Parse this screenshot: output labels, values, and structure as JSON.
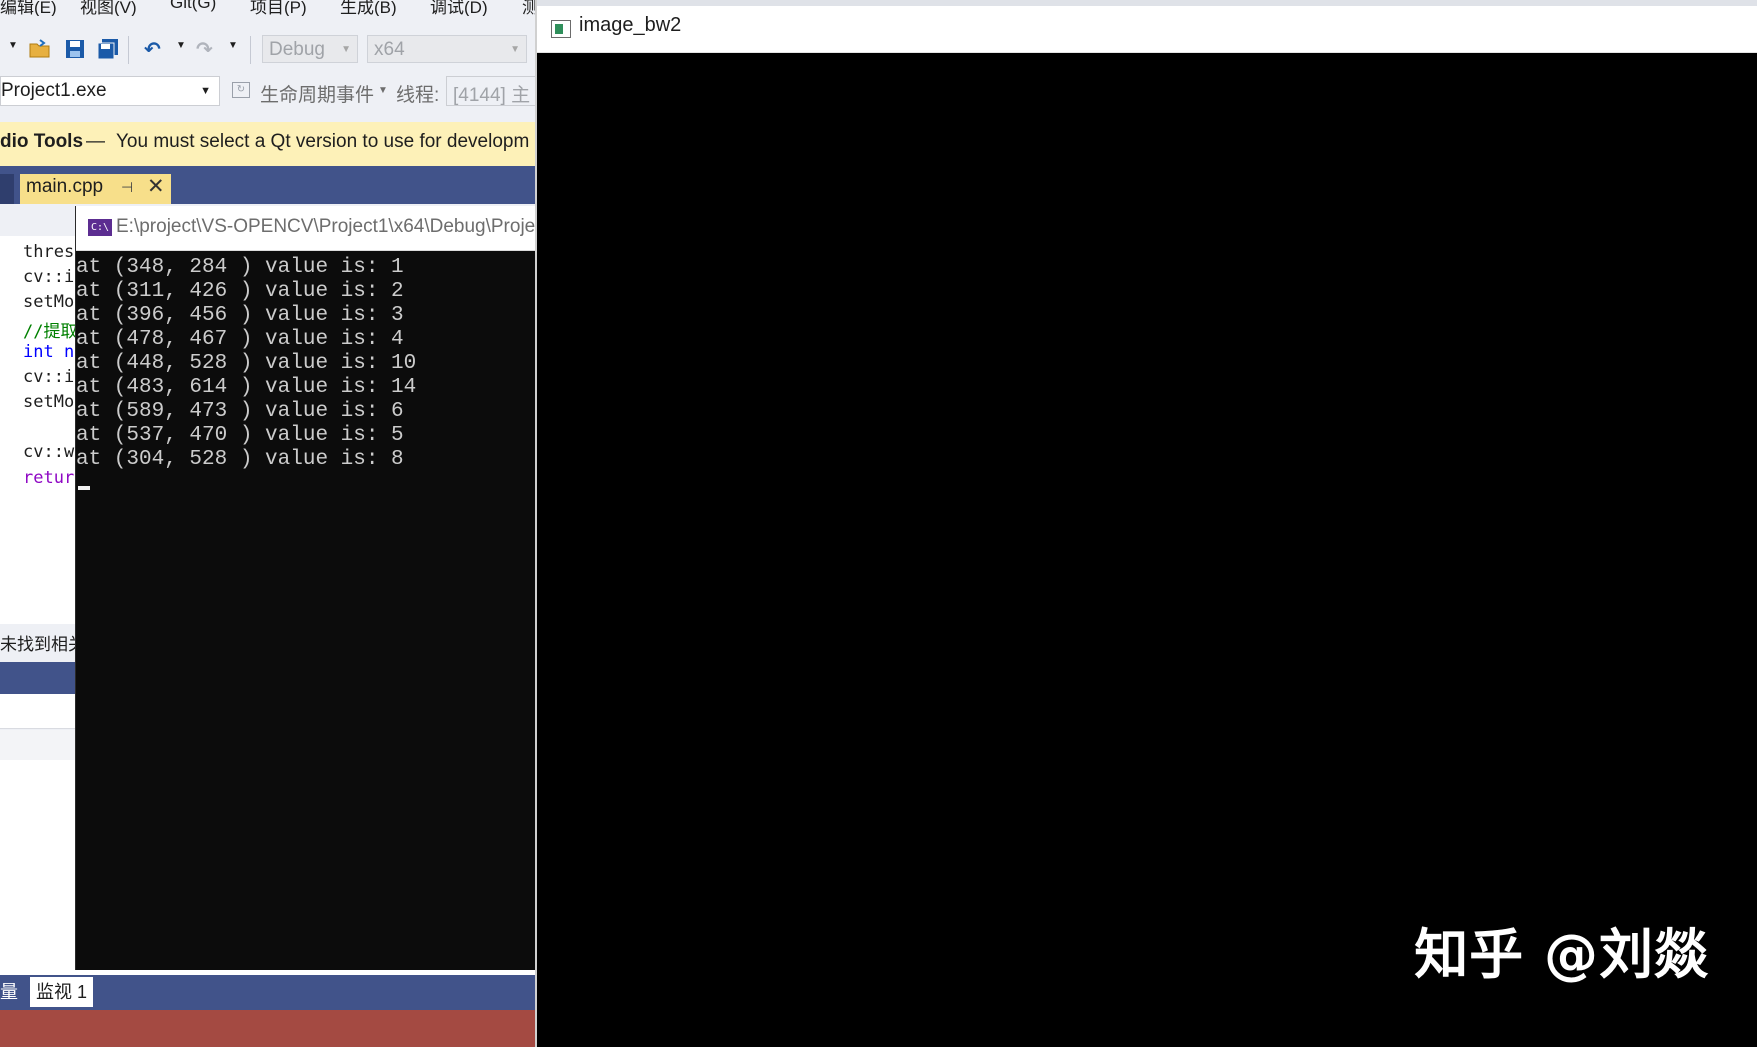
{
  "vs": {
    "menu": [
      "编辑(E)",
      "视图(V)",
      "Git(G)",
      "项目(P)",
      "生成(B)",
      "调试(D)",
      "测"
    ],
    "toolbar": {
      "config": "Debug",
      "platform": "x64"
    },
    "debug_toolbar": {
      "process": "Project1.exe",
      "lifecycle_label": "生命周期事件",
      "thread_label": "线程:",
      "thread_value": "[4144] 主"
    },
    "infobar": {
      "product": "dio Tools",
      "dash": "—",
      "message": "You must select a Qt version to use for developm"
    },
    "tab": {
      "label": "main.cpp",
      "pin": "⊣",
      "close": "✕"
    },
    "code_lines": [
      {
        "text": "thresh",
        "color": "#1e1e1e"
      },
      {
        "text": "cv::im",
        "color": "#1e1e1e"
      },
      {
        "text": "setMou",
        "color": "#1e1e1e"
      },
      {
        "text": "//提取",
        "color": "#008000"
      },
      {
        "text": "int nu",
        "color": "#0000ff"
      },
      {
        "text": "cv::im",
        "color": "#1e1e1e"
      },
      {
        "text": "setMou",
        "color": "#1e1e1e"
      },
      {
        "text": "",
        "color": "#1e1e1e"
      },
      {
        "text": "cv::wa",
        "color": "#1e1e1e"
      },
      {
        "text": "return",
        "color": "#8f08c4"
      }
    ],
    "status_text": "未找到相关",
    "bottom_tabs": [
      "量",
      "监视 1"
    ]
  },
  "console": {
    "title": "E:\\project\\VS-OPENCV\\Project1\\x64\\Debug\\Proje",
    "icon": "C:\\",
    "lines": [
      "at (348, 284 ) value is: 1",
      "at (311, 426 ) value is: 2",
      "at (396, 456 ) value is: 3",
      "at (478, 467 ) value is: 4",
      "at (448, 528 ) value is: 10",
      "at (483, 614 ) value is: 14",
      "at (589, 473 ) value is: 6",
      "at (537, 470 ) value is: 5",
      "at (304, 528 ) value is: 8"
    ]
  },
  "image_window": {
    "title": "image_bw2",
    "watermark": "知乎 @刘燚"
  }
}
